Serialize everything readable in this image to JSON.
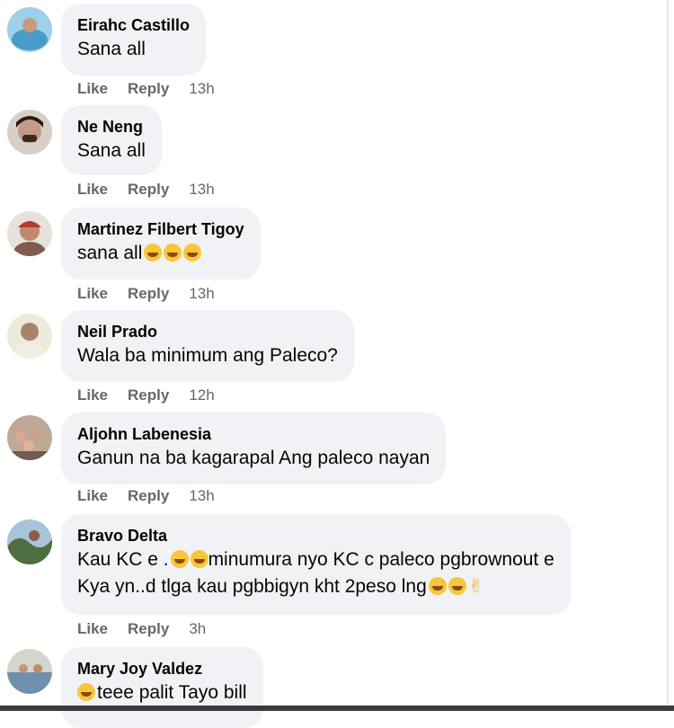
{
  "comments": [
    {
      "name": "Eirahc Castillo",
      "text": "Sana all",
      "like": "Like",
      "reply": "Reply",
      "time": "13h",
      "avatar_color": "#7fb6d9"
    },
    {
      "name": "Ne Neng",
      "text": "Sana all",
      "like": "Like",
      "reply": "Reply",
      "time": "13h",
      "avatar_color": "#5a3d35"
    },
    {
      "name": "Martinez Filbert Tigoy",
      "text": "sana all",
      "emoji": "😁😁😁",
      "like": "Like",
      "reply": "Reply",
      "time": "13h",
      "avatar_color": "#b35a4a"
    },
    {
      "name": "Neil Prado",
      "text": "Wala ba minimum ang Paleco?",
      "like": "Like",
      "reply": "Reply",
      "time": "12h",
      "avatar_color": "#c9b48a"
    },
    {
      "name": "Aljohn Labenesia",
      "text": "Ganun na ba kagarapal Ang paleco nayan",
      "like": "Like",
      "reply": "Reply",
      "time": "13h",
      "avatar_color": "#8f7564"
    },
    {
      "name": "Bravo Delta",
      "text_line1": "Kau KC e .",
      "text_line1b": "minumura nyo KC c paleco pgbrownout e",
      "text_line2": "Kya yn..d tlga kau pgbbigyn kht 2peso lng",
      "emoji_a": "😁😁",
      "emoji_b": "😂😂✌",
      "like": "Like",
      "reply": "Reply",
      "time": "3h",
      "avatar_color": "#5f7a52"
    },
    {
      "name": "Mary Joy Valdez",
      "text": "teee palit Tayo bill",
      "emoji": "🤣",
      "avatar_color": "#7a8fa3"
    }
  ]
}
